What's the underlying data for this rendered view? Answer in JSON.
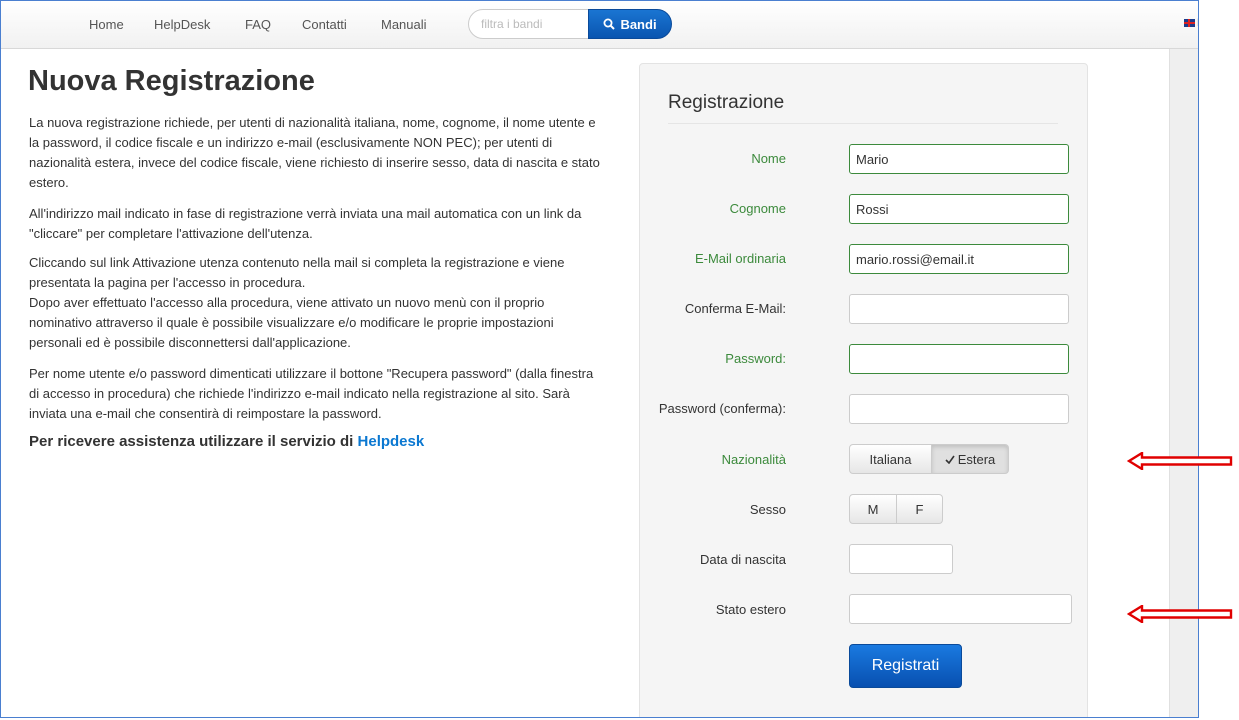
{
  "nav": {
    "links": [
      "Home",
      "HelpDesk",
      "FAQ",
      "Contatti",
      "Manuali"
    ],
    "search_placeholder": "filtra i bandi",
    "search_button": "Bandi",
    "search_icon": "magnifier-icon",
    "language": "En",
    "language_icon": "uk-flag-icon"
  },
  "intro": {
    "title": "Nuova Registrazione",
    "paragraphs": [
      "La nuova registrazione richiede, per utenti di nazionalità italiana, nome, cognome, il nome utente e la password, il codice fiscale e un indirizzo e-mail (esclusivamente NON PEC); per utenti di nazionalità estera, invece del codice fiscale, viene richiesto di inserire sesso, data di nascita e stato estero.",
      "All'indirizzo mail indicato in fase di registrazione verrà inviata una mail automatica con un link da \"cliccare\" per completare l'attivazione dell'utenza.",
      "Cliccando sul link Attivazione utenza contenuto nella mail si completa la registrazione e viene presentata la pagina per l'accesso in procedura.",
      "Dopo aver effettuato l'accesso alla procedura, viene attivato un nuovo menù con il proprio nominativo attraverso il quale è possibile visualizzare e/o modificare le proprie impostazioni personali ed è possibile disconnettersi dall'applicazione.",
      "Per nome utente e/o password dimenticati utilizzare il bottone \"Recupera password\" (dalla finestra di accesso in procedura) che richiede l'indirizzo e-mail indicato nella registrazione al sito. Sarà inviata una e-mail che consentirà di reimpostare la password."
    ],
    "assistance_text": "Per ricevere assistenza utilizzare il servizio di",
    "assistance_link": "Helpdesk"
  },
  "form": {
    "title": "Registrazione",
    "fields": [
      {
        "label": "Nome",
        "value": "Mario"
      },
      {
        "label": "Cognome",
        "value": "Rossi"
      },
      {
        "label": "E-Mail ordinaria",
        "value": "mario.rossi@email.it"
      },
      {
        "label": "Conferma E-Mail:",
        "value": ""
      },
      {
        "label": "Password:",
        "value": ""
      },
      {
        "label": "Password (conferma):",
        "value": ""
      }
    ],
    "nationality": {
      "label": "Nazionalità",
      "options": [
        "Italiana",
        "Estera"
      ],
      "selected": "Estera",
      "check_icon": "checkmark-icon"
    },
    "sex": {
      "label": "Sesso",
      "options": [
        "M",
        "F"
      ]
    },
    "birth_date": {
      "label": "Data di nascita",
      "value": ""
    },
    "foreign_state": {
      "label": "Stato estero",
      "value": ""
    },
    "submit": "Registrati"
  },
  "annotations": {
    "arrow_color": "#e00000",
    "arrow_icon": "left-arrow-icon"
  }
}
